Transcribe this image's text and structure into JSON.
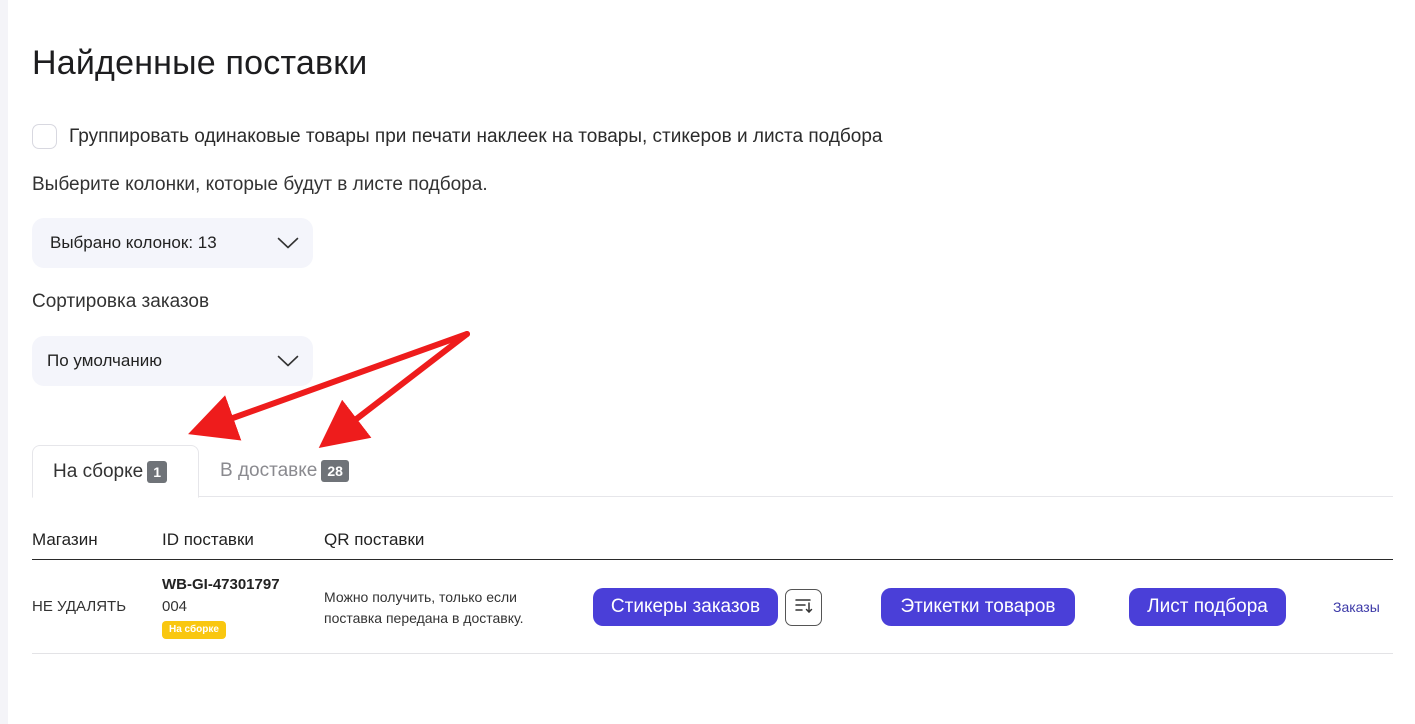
{
  "page": {
    "title": "Найденные поставки"
  },
  "options": {
    "group_label": "Группировать одинаковые товары при печати наклеек на товары, стикеров и листа подбора",
    "group_checked": false,
    "columns_hint": "Выберите колонки, которые будут в листе подбора.",
    "columns_select": "Выбрано колонок: 13",
    "sort_label": "Сортировка заказов",
    "sort_select": "По умолчанию"
  },
  "tabs": [
    {
      "label": "На сборке",
      "count": "1",
      "active": true
    },
    {
      "label": "В доставке",
      "count": "28",
      "active": false
    }
  ],
  "table": {
    "headers": {
      "store": "Магазин",
      "supply_id": "ID поставки",
      "qr": "QR поставки"
    },
    "rows": [
      {
        "store": "НЕ УДАЛЯТЬ",
        "supply_id": "WB-GI-47301797",
        "supply_suffix": "004",
        "status": "На сборке",
        "qr_note": "Можно получить, только если поставка передана в доставку.",
        "btn_stickers": "Стикеры заказов",
        "btn_labels": "Этикетки товаров",
        "btn_picklist": "Лист подбора",
        "link_orders": "Заказы"
      }
    ]
  },
  "colors": {
    "accent": "#4a3fd8",
    "status_badge": "#f9c710",
    "annotation_arrow": "#ee1c1c",
    "tab_badge": "#6f7378"
  },
  "icons": {
    "dropdown": "chevron-down-icon",
    "sort": "sort-icon"
  }
}
